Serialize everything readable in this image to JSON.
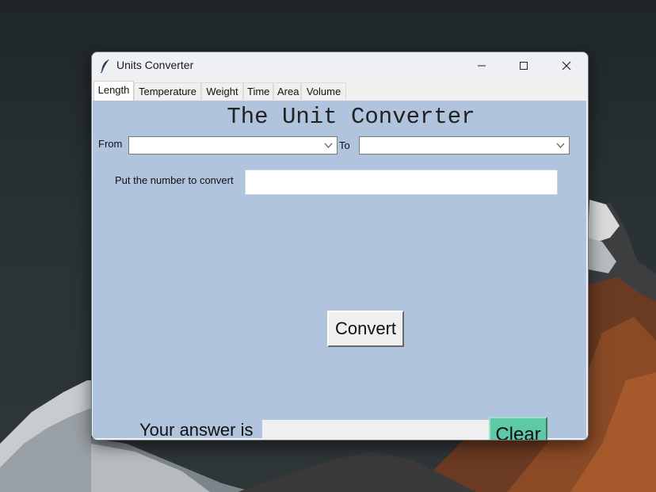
{
  "window": {
    "title": "Units Converter",
    "controls": [
      "minimize",
      "maximize",
      "close"
    ]
  },
  "tabs": [
    {
      "label": "Length",
      "active": true
    },
    {
      "label": "Temperature",
      "active": false
    },
    {
      "label": "Weight",
      "active": false
    },
    {
      "label": "Time",
      "active": false
    },
    {
      "label": "Area",
      "active": false
    },
    {
      "label": "Volume",
      "active": false
    }
  ],
  "main": {
    "heading": "The Unit Converter",
    "from_label": "From",
    "from_value": "",
    "to_label": "To",
    "to_value": "",
    "number_label": "Put the number to convert",
    "number_value": "",
    "convert_label": "Convert",
    "answer_label": "Your answer is",
    "answer_value": "",
    "clear_label": "Clear"
  },
  "colors": {
    "content_bg": "#b0c4de",
    "clear_button": "#5fc9a6",
    "titlebar": "#eef0f3"
  },
  "icons": {
    "app": "feather-icon",
    "dropdown": "chevron-down-icon"
  }
}
